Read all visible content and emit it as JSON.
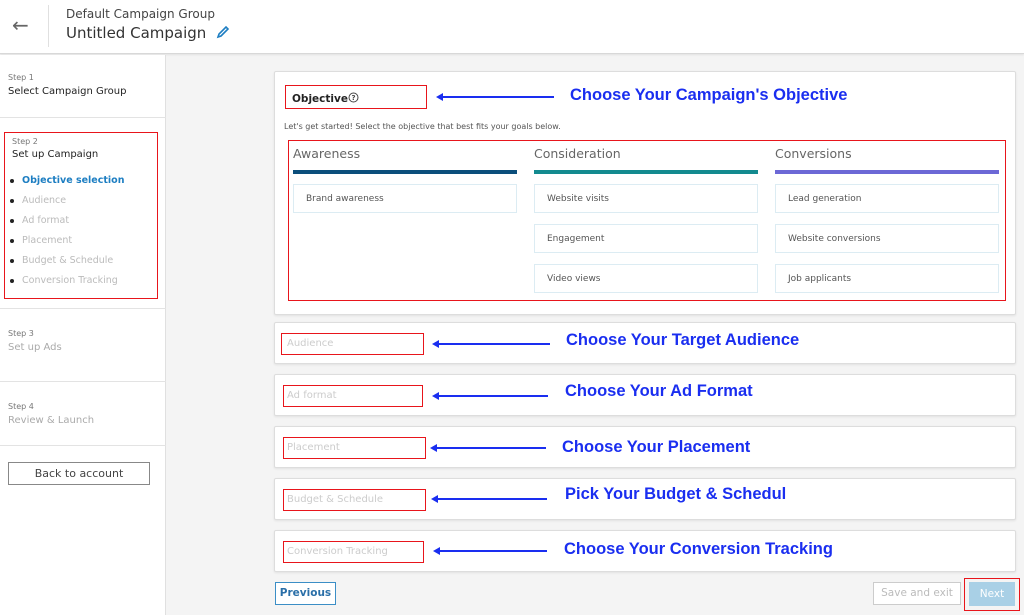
{
  "header": {
    "back_icon": "arrow-left-icon",
    "group_name": "Default Campaign Group",
    "campaign_name": "Untitled Campaign",
    "edit_icon": "pencil-icon"
  },
  "sidebar": {
    "steps": [
      {
        "label": "Step 1",
        "title": "Select Campaign Group"
      },
      {
        "label": "Step 2",
        "title": "Set up Campaign",
        "substeps": [
          {
            "label": "Objective selection",
            "active": true
          },
          {
            "label": "Audience"
          },
          {
            "label": "Ad format"
          },
          {
            "label": "Placement"
          },
          {
            "label": "Budget & Schedule"
          },
          {
            "label": "Conversion Tracking"
          }
        ]
      },
      {
        "label": "Step 3",
        "title": "Set up Ads"
      },
      {
        "label": "Step 4",
        "title": "Review & Launch"
      }
    ],
    "back_button": "Back to account"
  },
  "objective": {
    "title": "Objective",
    "help_icon": "question-circle-icon",
    "description": "Let's get started! Select the objective that best fits your goals below.",
    "columns": [
      {
        "title": "Awareness",
        "color": "#0b4e7b",
        "options": [
          "Brand awareness"
        ]
      },
      {
        "title": "Consideration",
        "color": "#138a8f",
        "options": [
          "Website visits",
          "Engagement",
          "Video views"
        ]
      },
      {
        "title": "Conversions",
        "color": "#6c68d6",
        "options": [
          "Lead generation",
          "Website conversions",
          "Job applicants"
        ]
      }
    ]
  },
  "sections": [
    {
      "label": "Audience"
    },
    {
      "label": "Ad format"
    },
    {
      "label": "Placement"
    },
    {
      "label": "Budget & Schedule"
    },
    {
      "label": "Conversion Tracking"
    }
  ],
  "annotations": {
    "objective": "Choose Your Campaign's Objective",
    "audience": "Choose Your Target Audience",
    "ad_format": "Choose Your Ad Format",
    "placement": "Choose Your Placement",
    "budget": "Pick Your Budget & Schedul",
    "conversion": "Choose Your Conversion Tracking"
  },
  "footer": {
    "previous": "Previous",
    "save_exit": "Save and exit",
    "next": "Next"
  }
}
